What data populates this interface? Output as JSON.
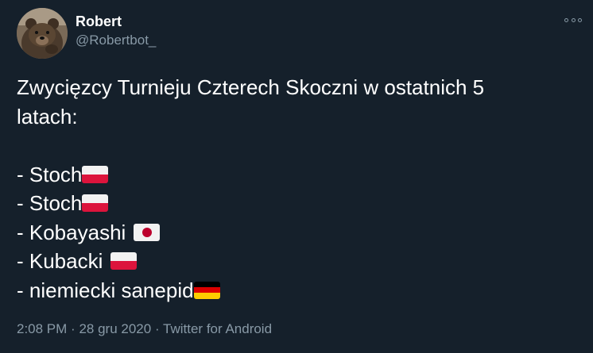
{
  "top_partial_text": "...  ...",
  "tweet": {
    "author": {
      "display_name": "Robert",
      "handle": "@Robertbot_",
      "avatar_icon": "bear-avatar"
    },
    "more_icon": "more-dots-icon",
    "text": {
      "heading_line1": "Zwycięzcy Turnieju Czterech Skoczni w ostatnich 5",
      "heading_line2": "latach:",
      "items": [
        {
          "label": "- Stoch",
          "flag": "poland-flag-icon"
        },
        {
          "label": "- Stoch",
          "flag": "poland-flag-icon"
        },
        {
          "label": "- Kobayashi",
          "flag": "japan-flag-icon"
        },
        {
          "label": "- Kubacki",
          "flag": "poland-flag-icon"
        },
        {
          "label": "- niemiecki sanepid",
          "flag": "germany-flag-icon"
        }
      ]
    },
    "meta": {
      "time": "2:08 PM",
      "separator": "·",
      "date": "28 gru 2020",
      "source": "Twitter for Android"
    }
  },
  "colors": {
    "background": "#15202b",
    "text_primary": "#ffffff",
    "text_secondary": "#8899a6",
    "poland_red": "#dc143c",
    "japan_red": "#bc002d",
    "germany_gold": "#ffce00"
  }
}
